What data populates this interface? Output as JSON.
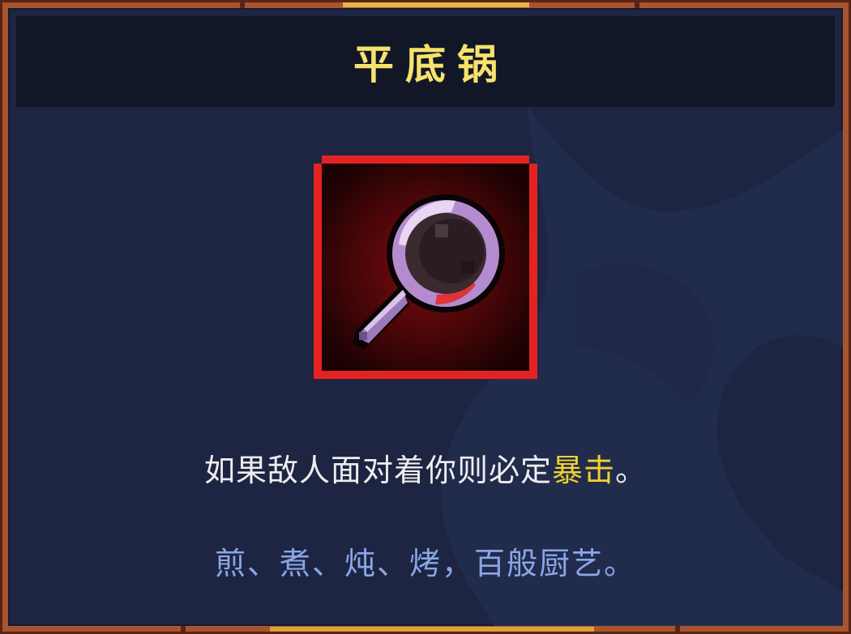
{
  "item": {
    "name": "平底锅",
    "icon": "frying-pan-icon",
    "description": {
      "before": "如果敌人面对着你则必定",
      "keyword": "暴击",
      "after": "。"
    },
    "flavor_text": "煎、煮、炖、烤，百般厨艺。"
  },
  "colors": {
    "title": "#f7e36b",
    "keyword": "#f2d22e",
    "flavor": "#8aa6e6",
    "icon_border": "#e52222",
    "panel_bg": "#1d2542",
    "frame": "#a8542e"
  }
}
